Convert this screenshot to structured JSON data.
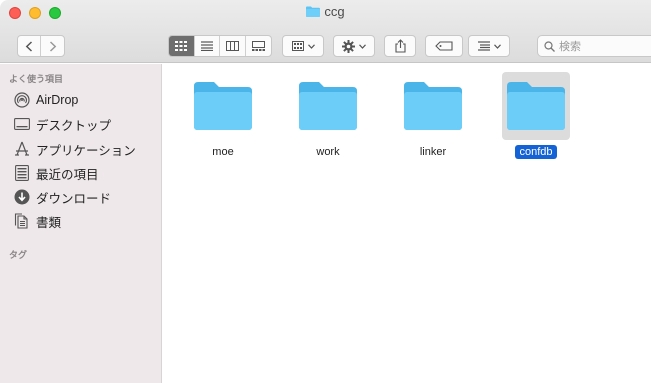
{
  "window": {
    "title": "ccg"
  },
  "toolbar": {
    "nav_back": "‹",
    "nav_forward": "›",
    "search_placeholder": "検索"
  },
  "sidebar": {
    "favorites_heading": "よく使う項目",
    "items": [
      {
        "label": "AirDrop",
        "icon": "airdrop-icon"
      },
      {
        "label": "デスクトップ",
        "icon": "desktop-icon"
      },
      {
        "label": "アプリケーション",
        "icon": "applications-icon"
      },
      {
        "label": "最近の項目",
        "icon": "recents-icon"
      },
      {
        "label": "ダウンロード",
        "icon": "downloads-icon"
      },
      {
        "label": "書類",
        "icon": "documents-icon"
      }
    ],
    "tags_heading": "タグ"
  },
  "files": [
    {
      "name": "moe",
      "type": "folder",
      "selected": false
    },
    {
      "name": "work",
      "type": "folder",
      "selected": false
    },
    {
      "name": "linker",
      "type": "folder",
      "selected": false
    },
    {
      "name": "confdb",
      "type": "folder",
      "selected": true
    }
  ],
  "colors": {
    "folder": "#5bc4f5",
    "selection": "#1463d6",
    "sidebar_bg": "#eee8ea"
  }
}
